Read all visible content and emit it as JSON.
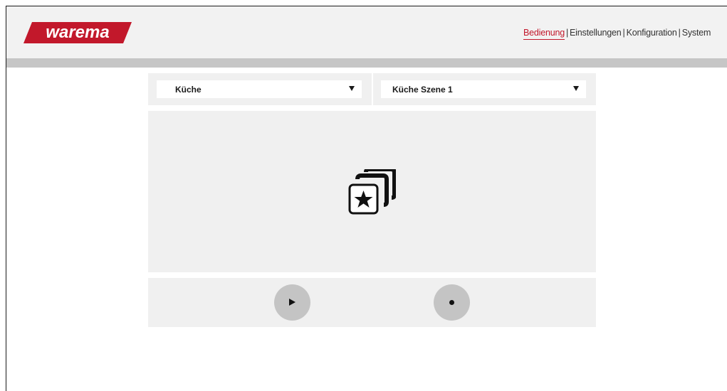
{
  "brand": {
    "logo_text": "warema",
    "accent_color": "#c2182b"
  },
  "nav": {
    "items": [
      {
        "label": "Bedienung",
        "active": true
      },
      {
        "label": "Einstellungen",
        "active": false
      },
      {
        "label": "Konfiguration",
        "active": false
      },
      {
        "label": "System",
        "active": false
      }
    ],
    "separator": "|"
  },
  "selectors": {
    "room": {
      "value": "Küche",
      "icon": "triangle-down-icon"
    },
    "scene": {
      "value": "Küche Szene 1",
      "icon": "triangle-down-icon"
    }
  },
  "scene_view": {
    "icon": "scene-star-stack-icon"
  },
  "controls": {
    "play": {
      "icon": "play-icon"
    },
    "record": {
      "icon": "record-icon"
    }
  }
}
